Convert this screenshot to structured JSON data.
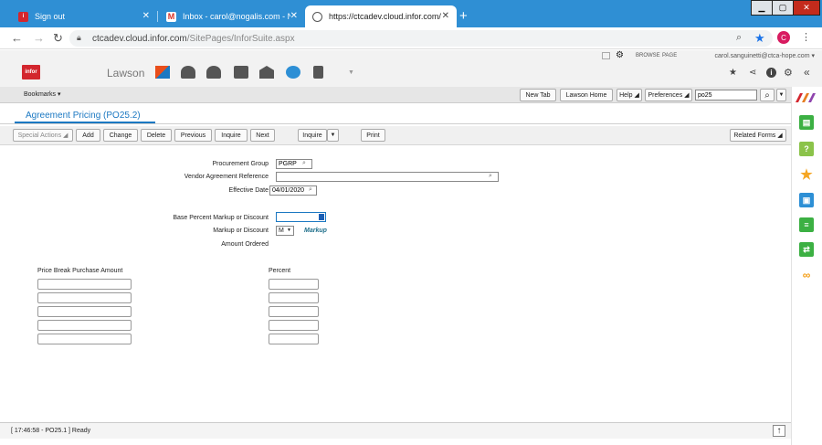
{
  "browser": {
    "tabs": [
      {
        "title": "Sign out",
        "icon": "infor-icon"
      },
      {
        "title": "Inbox - carol@nogalis.com - Nog",
        "icon": "gmail-icon"
      },
      {
        "title": "https://ctcadev.cloud.infor.com/",
        "icon": "globe-icon"
      }
    ],
    "url_host": "ctcadev.cloud.infor.com",
    "url_path": "/SitePages/InforSuite.aspx",
    "profile_initial": "C"
  },
  "header": {
    "logo_text": "infor",
    "app_name": "Lawson",
    "browse_label": "BROWSE",
    "page_label": "PAGE",
    "user": "carol.sanguinetti@ctca-hope.com"
  },
  "bookmarks_bar": {
    "bookmarks_label": "Bookmarks",
    "new_tab": "New Tab",
    "lawson_home": "Lawson Home",
    "help": "Help",
    "preferences": "Preferences",
    "search_value": "po25"
  },
  "form": {
    "title": "Agreement Pricing (PO25.2)",
    "toolbar": {
      "special_actions": "Special Actions",
      "add": "Add",
      "change": "Change",
      "delete": "Delete",
      "previous": "Previous",
      "inquire": "Inquire",
      "next": "Next",
      "inquire_menu": "Inquire",
      "print": "Print",
      "related_forms": "Related Forms"
    },
    "fields": {
      "procurement_group_label": "Procurement Group",
      "procurement_group_value": "PGRP",
      "vendor_agreement_label": "Vendor Agreement Reference",
      "vendor_agreement_value": "",
      "effective_date_label": "Effective Date",
      "effective_date_value": "04/01/2020",
      "base_percent_label": "Base Percent Markup or Discount",
      "base_percent_value": "",
      "markup_or_discount_label": "Markup or Discount",
      "markup_or_discount_value": "M",
      "markup_desc": "Markup",
      "amount_ordered_label": "Amount Ordered"
    },
    "grid": {
      "col1_header": "Price Break Purchase Amount",
      "col2_header": "Percent",
      "rows": 5
    }
  },
  "status": {
    "text": "[ 17:46:58 - PO25.1 ] Ready"
  },
  "colors": {
    "browser_blue": "#2f8fd4",
    "infor_red": "#d3262e",
    "title_blue": "#1b78c2",
    "markup_teal": "#1f6f8b"
  }
}
